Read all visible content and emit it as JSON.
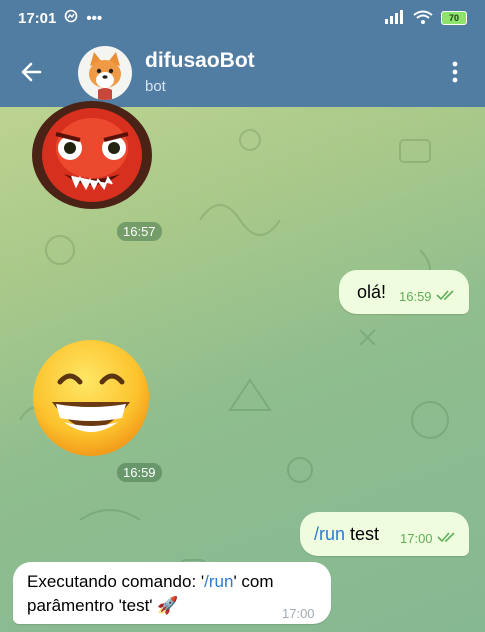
{
  "status_bar": {
    "time": "17:01",
    "battery": "70"
  },
  "header": {
    "title": "difusaoBot",
    "subtitle": "bot"
  },
  "messages": [
    {
      "kind": "sticker",
      "icon": "devil-mask-sticker",
      "time": "16:57"
    },
    {
      "kind": "outgoing",
      "text": "olá!",
      "time": "16:59"
    },
    {
      "kind": "sticker",
      "icon": "grinning-face-sticker",
      "time": "16:59"
    },
    {
      "kind": "outgoing",
      "command": "/run",
      "text": " test",
      "time": "17:00"
    },
    {
      "kind": "incoming",
      "prefix": "Executando comando: '",
      "command": "/run",
      "suffix": "' com",
      "line2": "parâmentro 'test' 🚀",
      "time": "17:00"
    }
  ],
  "colors": {
    "header": "#527da3",
    "outgoing_bubble": "#effdde",
    "link": "#2c7bd4",
    "check": "#5eae5a"
  }
}
